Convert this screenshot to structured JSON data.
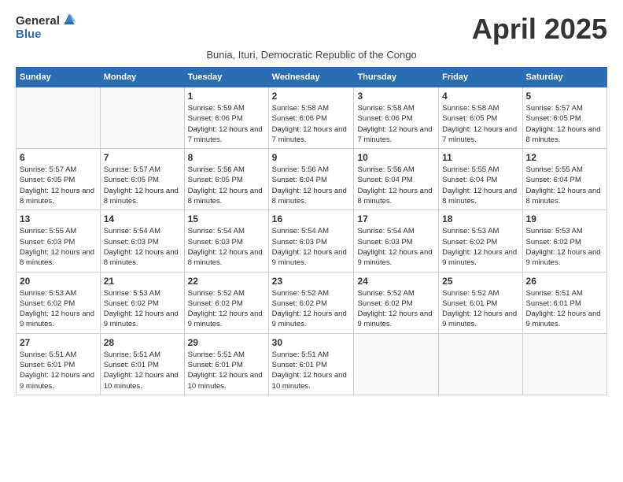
{
  "logo": {
    "general": "General",
    "blue": "Blue"
  },
  "title": "April 2025",
  "subtitle": "Bunia, Ituri, Democratic Republic of the Congo",
  "headers": [
    "Sunday",
    "Monday",
    "Tuesday",
    "Wednesday",
    "Thursday",
    "Friday",
    "Saturday"
  ],
  "weeks": [
    [
      {
        "day": "",
        "detail": ""
      },
      {
        "day": "",
        "detail": ""
      },
      {
        "day": "1",
        "detail": "Sunrise: 5:59 AM\nSunset: 6:06 PM\nDaylight: 12 hours and 7 minutes."
      },
      {
        "day": "2",
        "detail": "Sunrise: 5:58 AM\nSunset: 6:06 PM\nDaylight: 12 hours and 7 minutes."
      },
      {
        "day": "3",
        "detail": "Sunrise: 5:58 AM\nSunset: 6:06 PM\nDaylight: 12 hours and 7 minutes."
      },
      {
        "day": "4",
        "detail": "Sunrise: 5:58 AM\nSunset: 6:05 PM\nDaylight: 12 hours and 7 minutes."
      },
      {
        "day": "5",
        "detail": "Sunrise: 5:57 AM\nSunset: 6:05 PM\nDaylight: 12 hours and 8 minutes."
      }
    ],
    [
      {
        "day": "6",
        "detail": "Sunrise: 5:57 AM\nSunset: 6:05 PM\nDaylight: 12 hours and 8 minutes."
      },
      {
        "day": "7",
        "detail": "Sunrise: 5:57 AM\nSunset: 6:05 PM\nDaylight: 12 hours and 8 minutes."
      },
      {
        "day": "8",
        "detail": "Sunrise: 5:56 AM\nSunset: 6:05 PM\nDaylight: 12 hours and 8 minutes."
      },
      {
        "day": "9",
        "detail": "Sunrise: 5:56 AM\nSunset: 6:04 PM\nDaylight: 12 hours and 8 minutes."
      },
      {
        "day": "10",
        "detail": "Sunrise: 5:56 AM\nSunset: 6:04 PM\nDaylight: 12 hours and 8 minutes."
      },
      {
        "day": "11",
        "detail": "Sunrise: 5:55 AM\nSunset: 6:04 PM\nDaylight: 12 hours and 8 minutes."
      },
      {
        "day": "12",
        "detail": "Sunrise: 5:55 AM\nSunset: 6:04 PM\nDaylight: 12 hours and 8 minutes."
      }
    ],
    [
      {
        "day": "13",
        "detail": "Sunrise: 5:55 AM\nSunset: 6:03 PM\nDaylight: 12 hours and 8 minutes."
      },
      {
        "day": "14",
        "detail": "Sunrise: 5:54 AM\nSunset: 6:03 PM\nDaylight: 12 hours and 8 minutes."
      },
      {
        "day": "15",
        "detail": "Sunrise: 5:54 AM\nSunset: 6:03 PM\nDaylight: 12 hours and 8 minutes."
      },
      {
        "day": "16",
        "detail": "Sunrise: 5:54 AM\nSunset: 6:03 PM\nDaylight: 12 hours and 9 minutes."
      },
      {
        "day": "17",
        "detail": "Sunrise: 5:54 AM\nSunset: 6:03 PM\nDaylight: 12 hours and 9 minutes."
      },
      {
        "day": "18",
        "detail": "Sunrise: 5:53 AM\nSunset: 6:02 PM\nDaylight: 12 hours and 9 minutes."
      },
      {
        "day": "19",
        "detail": "Sunrise: 5:53 AM\nSunset: 6:02 PM\nDaylight: 12 hours and 9 minutes."
      }
    ],
    [
      {
        "day": "20",
        "detail": "Sunrise: 5:53 AM\nSunset: 6:02 PM\nDaylight: 12 hours and 9 minutes."
      },
      {
        "day": "21",
        "detail": "Sunrise: 5:53 AM\nSunset: 6:02 PM\nDaylight: 12 hours and 9 minutes."
      },
      {
        "day": "22",
        "detail": "Sunrise: 5:52 AM\nSunset: 6:02 PM\nDaylight: 12 hours and 9 minutes."
      },
      {
        "day": "23",
        "detail": "Sunrise: 5:52 AM\nSunset: 6:02 PM\nDaylight: 12 hours and 9 minutes."
      },
      {
        "day": "24",
        "detail": "Sunrise: 5:52 AM\nSunset: 6:02 PM\nDaylight: 12 hours and 9 minutes."
      },
      {
        "day": "25",
        "detail": "Sunrise: 5:52 AM\nSunset: 6:01 PM\nDaylight: 12 hours and 9 minutes."
      },
      {
        "day": "26",
        "detail": "Sunrise: 5:51 AM\nSunset: 6:01 PM\nDaylight: 12 hours and 9 minutes."
      }
    ],
    [
      {
        "day": "27",
        "detail": "Sunrise: 5:51 AM\nSunset: 6:01 PM\nDaylight: 12 hours and 9 minutes."
      },
      {
        "day": "28",
        "detail": "Sunrise: 5:51 AM\nSunset: 6:01 PM\nDaylight: 12 hours and 10 minutes."
      },
      {
        "day": "29",
        "detail": "Sunrise: 5:51 AM\nSunset: 6:01 PM\nDaylight: 12 hours and 10 minutes."
      },
      {
        "day": "30",
        "detail": "Sunrise: 5:51 AM\nSunset: 6:01 PM\nDaylight: 12 hours and 10 minutes."
      },
      {
        "day": "",
        "detail": ""
      },
      {
        "day": "",
        "detail": ""
      },
      {
        "day": "",
        "detail": ""
      }
    ]
  ]
}
